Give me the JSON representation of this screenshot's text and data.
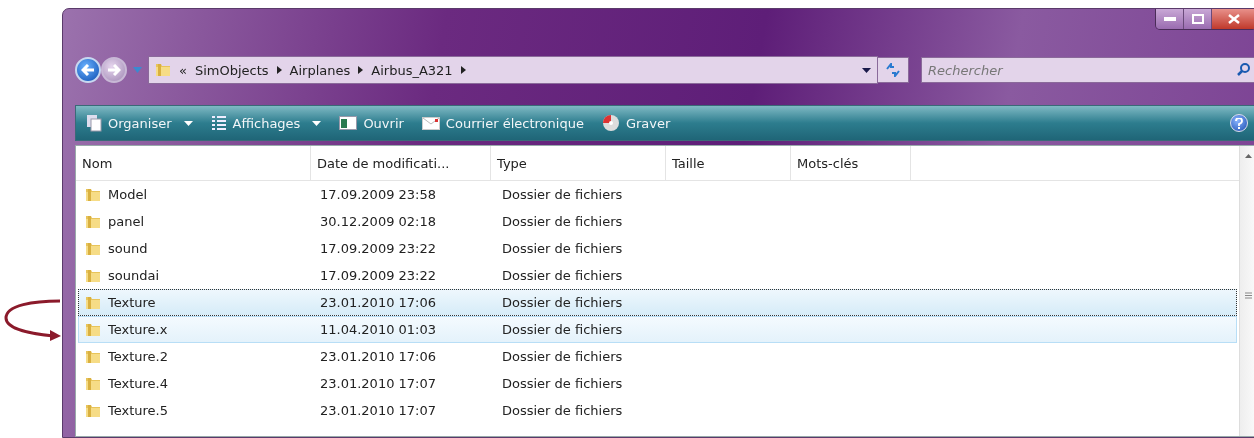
{
  "address_bar": {
    "overflow": "«",
    "path": [
      "SimObjects",
      "Airplanes",
      "Airbus_A321"
    ]
  },
  "search": {
    "placeholder": "Rechercher"
  },
  "toolbar": [
    {
      "label": "Organiser",
      "kind": "organize",
      "dropdown": true
    },
    {
      "label": "Affichages",
      "kind": "views",
      "dropdown": true
    },
    {
      "label": "Ouvrir",
      "kind": "open",
      "dropdown": false
    },
    {
      "label": "Courrier électronique",
      "kind": "mail",
      "dropdown": false
    },
    {
      "label": "Graver",
      "kind": "burn",
      "dropdown": false
    }
  ],
  "table": {
    "columns": [
      "Nom",
      "Date de modificati...",
      "Type",
      "Taille",
      "Mots-clés"
    ],
    "rows": [
      {
        "name": "Model",
        "date": "17.09.2009 23:58",
        "type": "Dossier de fichiers",
        "selected": false,
        "focused": false,
        "hovered": false
      },
      {
        "name": "panel",
        "date": "30.12.2009 02:18",
        "type": "Dossier de fichiers",
        "selected": false,
        "focused": false,
        "hovered": false
      },
      {
        "name": "sound",
        "date": "17.09.2009 23:22",
        "type": "Dossier de fichiers",
        "selected": false,
        "focused": false,
        "hovered": false
      },
      {
        "name": "soundai",
        "date": "17.09.2009 23:22",
        "type": "Dossier de fichiers",
        "selected": false,
        "focused": false,
        "hovered": false
      },
      {
        "name": "Texture",
        "date": "23.01.2010 17:06",
        "type": "Dossier de fichiers",
        "selected": true,
        "focused": true,
        "hovered": false
      },
      {
        "name": "Texture.x",
        "date": "11.04.2010 01:03",
        "type": "Dossier de fichiers",
        "selected": false,
        "focused": false,
        "hovered": true
      },
      {
        "name": "Texture.2",
        "date": "23.01.2010 17:06",
        "type": "Dossier de fichiers",
        "selected": false,
        "focused": false,
        "hovered": false
      },
      {
        "name": "Texture.4",
        "date": "23.01.2010 17:07",
        "type": "Dossier de fichiers",
        "selected": false,
        "focused": false,
        "hovered": false
      },
      {
        "name": "Texture.5",
        "date": "23.01.2010 17:07",
        "type": "Dossier de fichiers",
        "selected": false,
        "focused": false,
        "hovered": false
      }
    ]
  },
  "annotation": {
    "kind": "curved-arrow"
  }
}
